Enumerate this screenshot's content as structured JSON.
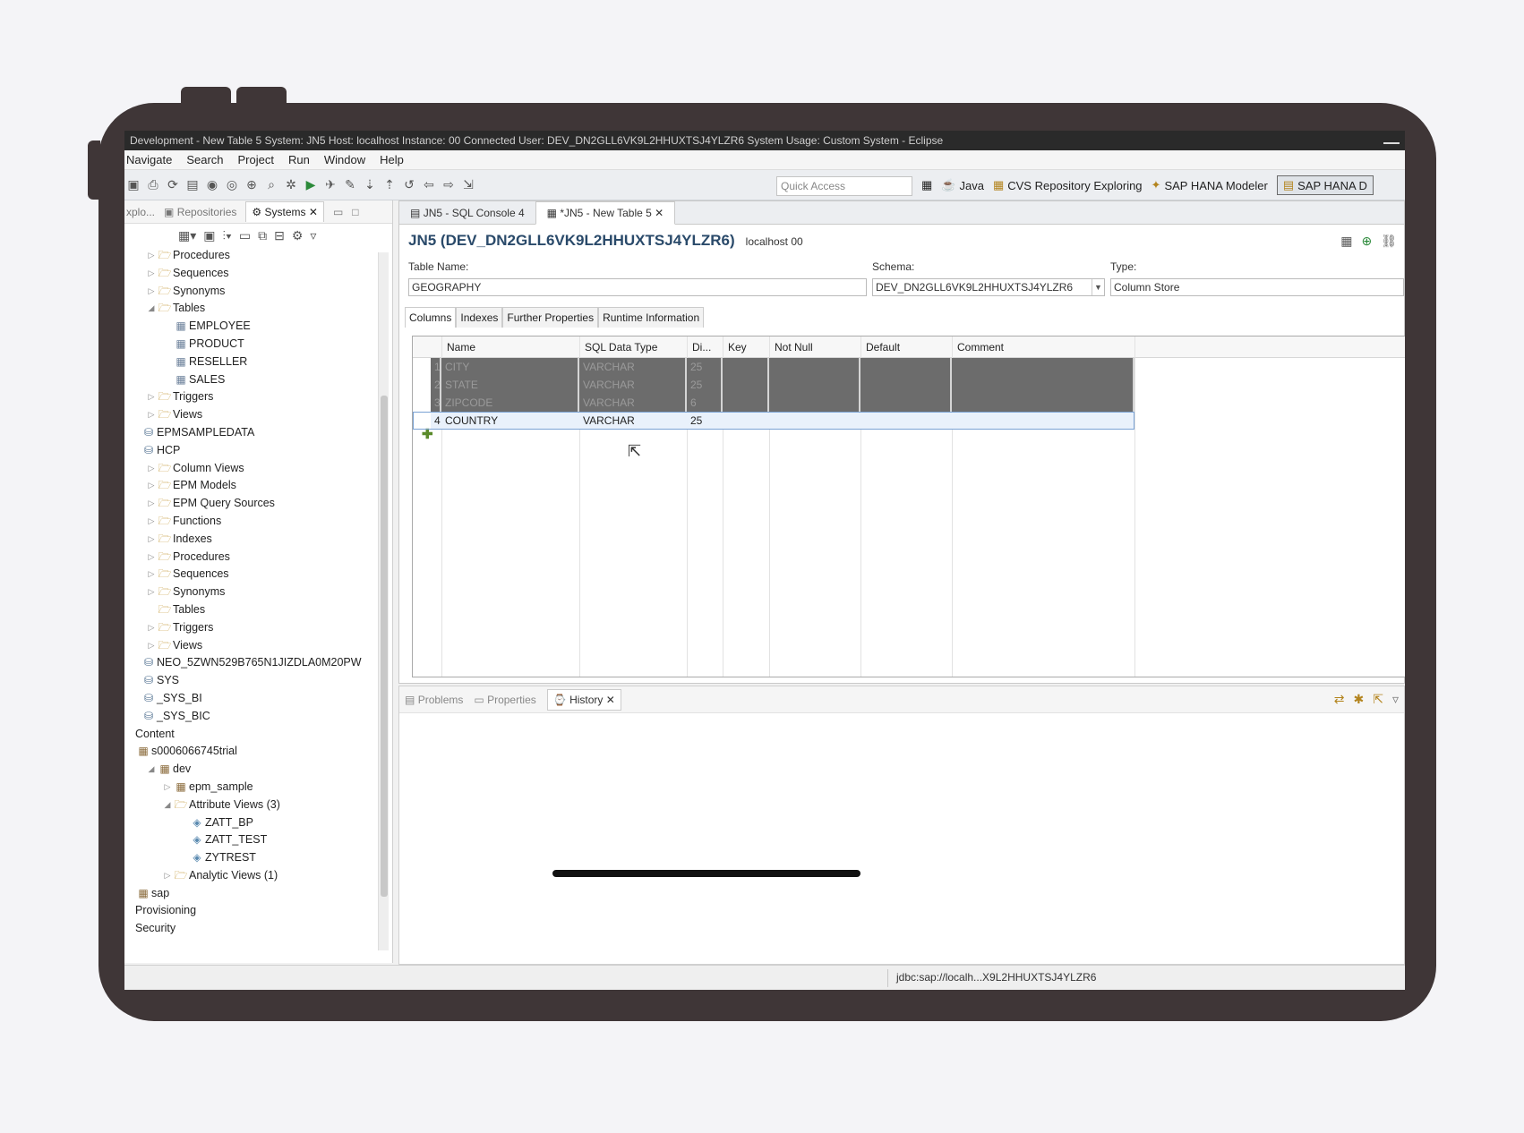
{
  "window": {
    "title": "Development - New Table 5 System: JN5 Host: localhost Instance: 00 Connected User: DEV_DN2GLL6VK9L2HHUXTSJ4YLZR6 System Usage: Custom System - Eclipse"
  },
  "menu": [
    "Navigate",
    "Search",
    "Project",
    "Run",
    "Window",
    "Help"
  ],
  "toolbar": {
    "quick_access_placeholder": "Quick Access"
  },
  "perspectives": [
    {
      "label": "Java",
      "icon": "java-perspective-icon"
    },
    {
      "label": "CVS Repository Exploring",
      "icon": "cvs-icon"
    },
    {
      "label": "SAP HANA Modeler",
      "icon": "modeler-icon"
    },
    {
      "label": "SAP HANA D",
      "icon": "hana-dev-icon",
      "active": true
    }
  ],
  "left_panel": {
    "tabs": [
      "xplo...",
      "Repositories",
      "Systems"
    ],
    "tree": [
      {
        "indent": 0,
        "arrow": "▷",
        "icon": "folder",
        "label": "Procedures"
      },
      {
        "indent": 0,
        "arrow": "▷",
        "icon": "folder",
        "label": "Sequences"
      },
      {
        "indent": 0,
        "arrow": "▷",
        "icon": "folder",
        "label": "Synonyms"
      },
      {
        "indent": 0,
        "arrow": "◢",
        "icon": "folder",
        "label": "Tables"
      },
      {
        "indent": 1,
        "arrow": "",
        "icon": "table",
        "label": "EMPLOYEE"
      },
      {
        "indent": 1,
        "arrow": "",
        "icon": "table",
        "label": "PRODUCT"
      },
      {
        "indent": 1,
        "arrow": "",
        "icon": "table",
        "label": "RESELLER"
      },
      {
        "indent": 1,
        "arrow": "",
        "icon": "table",
        "label": "SALES"
      },
      {
        "indent": 0,
        "arrow": "▷",
        "icon": "folder",
        "label": "Triggers"
      },
      {
        "indent": 0,
        "arrow": "▷",
        "icon": "folder",
        "label": "Views"
      },
      {
        "indent": -1,
        "arrow": "",
        "icon": "schema",
        "label": "EPMSAMPLEDATA"
      },
      {
        "indent": -1,
        "arrow": "",
        "icon": "schema",
        "label": "HCP"
      },
      {
        "indent": 0,
        "arrow": "▷",
        "icon": "folder",
        "label": "Column Views"
      },
      {
        "indent": 0,
        "arrow": "▷",
        "icon": "folder",
        "label": "EPM Models"
      },
      {
        "indent": 0,
        "arrow": "▷",
        "icon": "folder",
        "label": "EPM Query Sources"
      },
      {
        "indent": 0,
        "arrow": "▷",
        "icon": "folder",
        "label": "Functions"
      },
      {
        "indent": 0,
        "arrow": "▷",
        "icon": "folder",
        "label": "Indexes"
      },
      {
        "indent": 0,
        "arrow": "▷",
        "icon": "folder",
        "label": "Procedures"
      },
      {
        "indent": 0,
        "arrow": "▷",
        "icon": "folder",
        "label": "Sequences"
      },
      {
        "indent": 0,
        "arrow": "▷",
        "icon": "folder",
        "label": "Synonyms"
      },
      {
        "indent": 0,
        "arrow": "",
        "icon": "folder",
        "label": "Tables"
      },
      {
        "indent": 0,
        "arrow": "▷",
        "icon": "folder",
        "label": "Triggers"
      },
      {
        "indent": 0,
        "arrow": "▷",
        "icon": "folder",
        "label": "Views"
      },
      {
        "indent": -1,
        "arrow": "",
        "icon": "schema",
        "label": "NEO_5ZWN529B765N1JIZDLA0M20PW"
      },
      {
        "indent": -1,
        "arrow": "",
        "icon": "schema",
        "label": "SYS"
      },
      {
        "indent": -1,
        "arrow": "",
        "icon": "schema",
        "label": "_SYS_BI"
      },
      {
        "indent": -1,
        "arrow": "",
        "icon": "schema",
        "label": "_SYS_BIC"
      },
      {
        "indent": -2,
        "arrow": "",
        "icon": "",
        "label": "Content"
      },
      {
        "indent": -2,
        "arrow": "",
        "icon": "pkg",
        "label": "s0006066745trial"
      },
      {
        "indent": 0,
        "arrow": "◢",
        "icon": "pkg",
        "label": "dev"
      },
      {
        "indent": 1,
        "arrow": "▷",
        "icon": "pkg",
        "label": "epm_sample"
      },
      {
        "indent": 1,
        "arrow": "◢",
        "icon": "folder",
        "label": "Attribute Views (3)"
      },
      {
        "indent": 2,
        "arrow": "",
        "icon": "view",
        "label": "ZATT_BP"
      },
      {
        "indent": 2,
        "arrow": "",
        "icon": "view",
        "label": "ZATT_TEST"
      },
      {
        "indent": 2,
        "arrow": "",
        "icon": "view",
        "label": "ZYTREST"
      },
      {
        "indent": 1,
        "arrow": "▷",
        "icon": "folder",
        "label": "Analytic Views (1)"
      },
      {
        "indent": -2,
        "arrow": "",
        "icon": "pkg",
        "label": "sap"
      },
      {
        "indent": -2,
        "arrow": "",
        "icon": "",
        "label": "Provisioning"
      },
      {
        "indent": -2,
        "arrow": "",
        "icon": "",
        "label": "Security"
      }
    ]
  },
  "editor": {
    "tabs": [
      {
        "label": "JN5 - SQL Console 4",
        "active": false
      },
      {
        "label": "*JN5 - New Table 5",
        "active": true
      }
    ],
    "heading": "JN5 (DEV_DN2GLL6VK9L2HHUXTSJ4YLZR6)",
    "host": "localhost 00",
    "table_name_label": "Table Name:",
    "table_name_value": "GEOGRAPHY",
    "schema_label": "Schema:",
    "schema_value": "DEV_DN2GLL6VK9L2HHUXTSJ4YLZR6",
    "type_label": "Type:",
    "type_value": "Column Store",
    "content_tabs": [
      "Columns",
      "Indexes",
      "Further Properties",
      "Runtime Information"
    ],
    "columns_header": [
      "Name",
      "SQL Data Type",
      "Di...",
      "Key",
      "Not Null",
      "Default",
      "Comment"
    ],
    "rows": [
      {
        "num": "1",
        "name": "CITY",
        "type": "VARCHAR",
        "dim": "25",
        "state": "dark"
      },
      {
        "num": "2",
        "name": "STATE",
        "type": "VARCHAR",
        "dim": "25",
        "state": "dark"
      },
      {
        "num": "3",
        "name": "ZIPCODE",
        "type": "VARCHAR",
        "dim": "6",
        "state": "dark"
      },
      {
        "num": "4",
        "name": "COUNTRY",
        "type": "VARCHAR",
        "dim": "25",
        "state": "selected"
      }
    ]
  },
  "bottom_panel": {
    "tabs": [
      "Problems",
      "Properties",
      "History"
    ]
  },
  "status_bar": {
    "connection": "jdbc:sap://localh...X9L2HHUXTSJ4YLZR6"
  }
}
